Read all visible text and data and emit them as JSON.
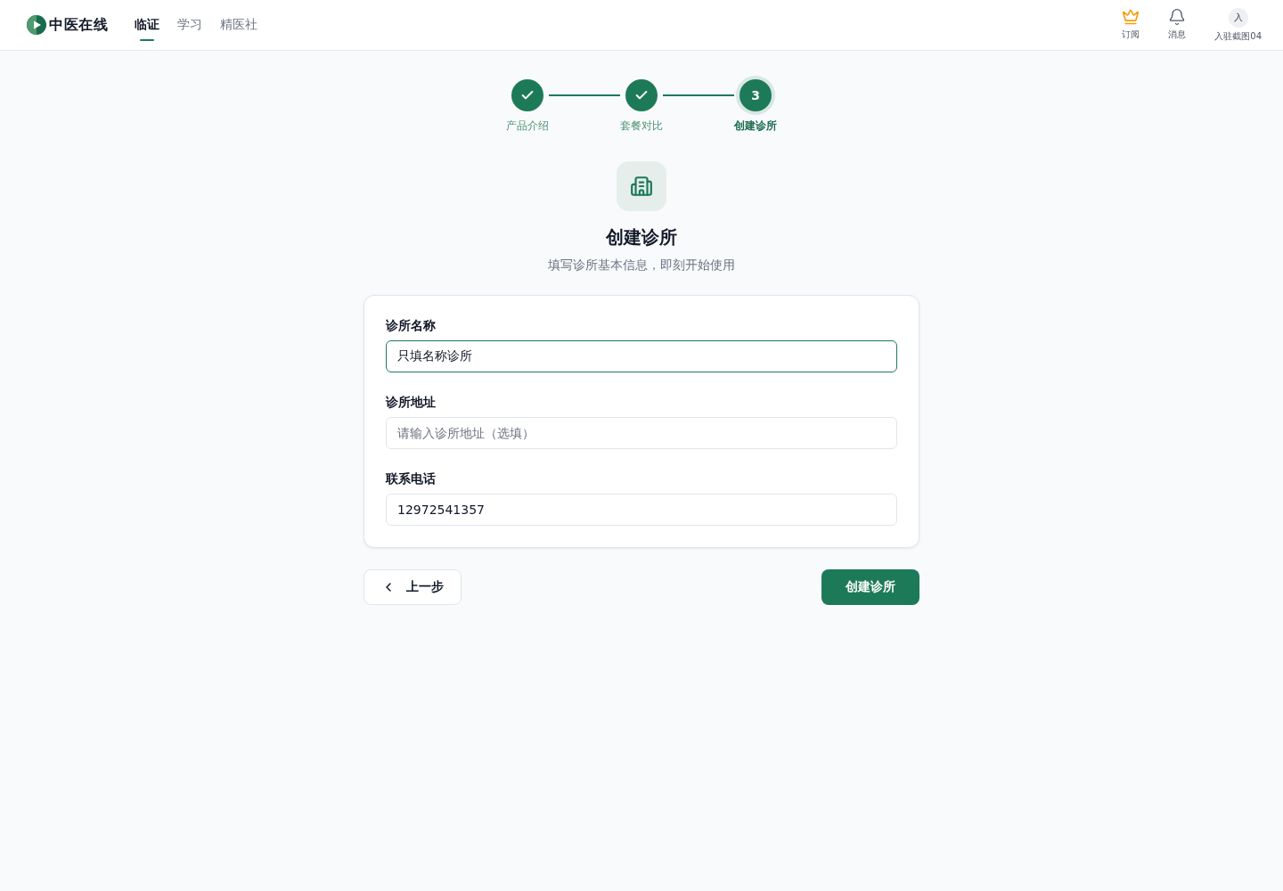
{
  "header": {
    "logo": "中医在线",
    "nav": [
      {
        "label": "临证",
        "selected": true
      },
      {
        "label": "学习",
        "selected": false
      },
      {
        "label": "精医社",
        "selected": false
      }
    ],
    "actions": [
      {
        "kind": "subscribe",
        "label": "订阅"
      },
      {
        "kind": "messages",
        "label": "消息"
      },
      {
        "kind": "account",
        "avatar": "入",
        "label": "入驻截图04"
      }
    ]
  },
  "steps": [
    {
      "label": "产品介绍",
      "done": true,
      "selected": false
    },
    {
      "label": "套餐对比",
      "done": true,
      "selected": false
    },
    {
      "label": "创建诊所",
      "number": "3",
      "done": false,
      "selected": true
    }
  ],
  "page": {
    "title": "创建诊所",
    "subtitle": "填写诊所基本信息，即刻开始使用"
  },
  "form": {
    "fields": [
      {
        "label": "诊所名称",
        "value": "只填名称诊所",
        "focused": true
      },
      {
        "label": "诊所地址",
        "placeholder": "请输入诊所地址（选填）",
        "focused": false
      },
      {
        "label": "联系电话",
        "value": "12972541357",
        "focused": false
      }
    ]
  },
  "buttons": {
    "back": "上一步",
    "submit": "创建诊所"
  }
}
